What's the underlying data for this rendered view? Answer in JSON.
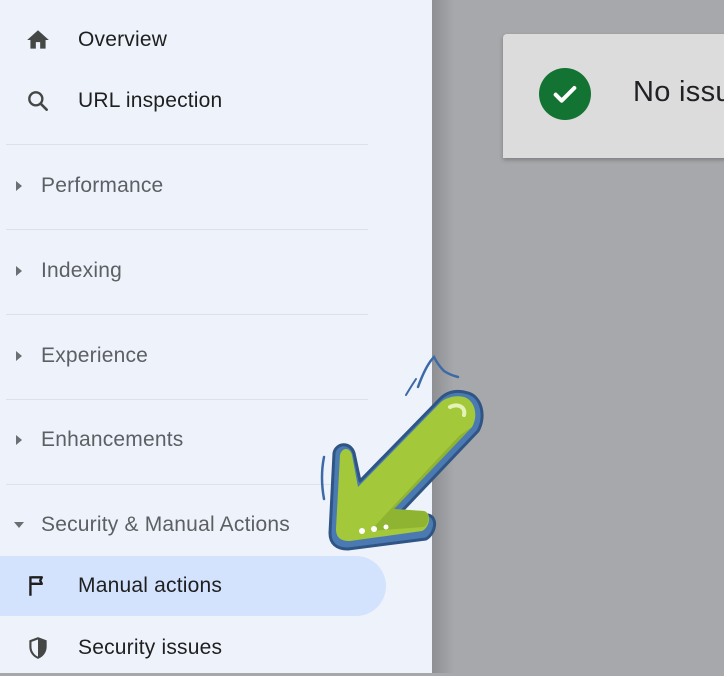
{
  "sidebar": {
    "top_items": [
      {
        "label": "Overview",
        "icon": "home-icon"
      },
      {
        "label": "URL inspection",
        "icon": "search-icon"
      }
    ],
    "sections": [
      {
        "label": "Performance",
        "expanded": false
      },
      {
        "label": "Indexing",
        "expanded": false
      },
      {
        "label": "Experience",
        "expanded": false
      },
      {
        "label": "Enhancements",
        "expanded": false
      },
      {
        "label": "Security & Manual Actions",
        "expanded": true
      }
    ],
    "sub_items": [
      {
        "label": "Manual actions",
        "icon": "flag-icon",
        "active": true
      },
      {
        "label": "Security issues",
        "icon": "shield-icon",
        "active": false
      }
    ]
  },
  "status_card": {
    "message": "No issu",
    "icon": "check-circle-icon"
  },
  "annotation": {
    "icon": "pointer-arrow-icon",
    "color": "#a3c93a"
  },
  "colors": {
    "sidebar_bg": "#eef3fb",
    "active_bg": "#d3e3fd",
    "success": "#137333",
    "overlay": "#a6a8ab"
  }
}
